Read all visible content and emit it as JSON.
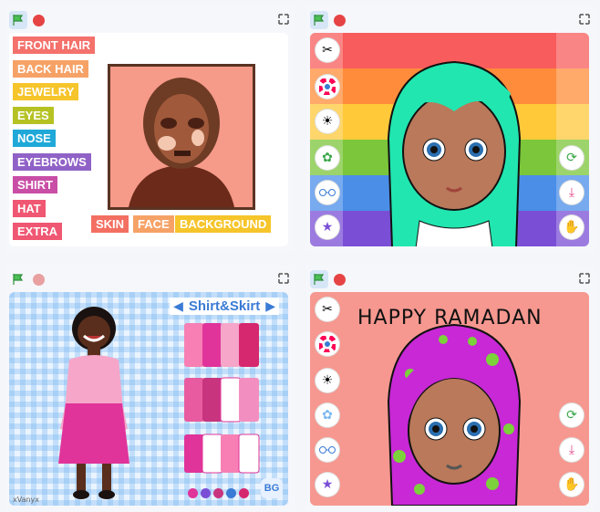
{
  "panel1": {
    "menu": [
      "FRONT HAIR",
      "BACK HAIR",
      "JEWELRY",
      "EYES",
      "NOSE",
      "EYEBROWS",
      "SHIRT",
      "HAT",
      "EXTRA"
    ],
    "menu_colors": [
      "#f4716c",
      "#f6a267",
      "#f6c52b",
      "#b6c224",
      "#20a9d8",
      "#9062c7",
      "#c94ea6",
      "#f05772",
      "#f05772"
    ],
    "bottom": [
      "SKIN",
      "FACE",
      "BACKGROUND"
    ],
    "bottom_colors": [
      "#f36f62",
      "#f6a267",
      "#f6c52b"
    ]
  },
  "panel3": {
    "title": "Shirt&Skirt",
    "bg_label": "BG",
    "credit": "xVanyx"
  },
  "panel4": {
    "caption": "HAPPY RAMADAN"
  },
  "icons": {
    "side_left": [
      "scissors-icon",
      "color-wheel-icon",
      "sun-icon",
      "flower-icon",
      "glasses-icon",
      "star-icon"
    ],
    "side_right": [
      "refresh-icon",
      "download-icon",
      "hand-icon"
    ]
  }
}
